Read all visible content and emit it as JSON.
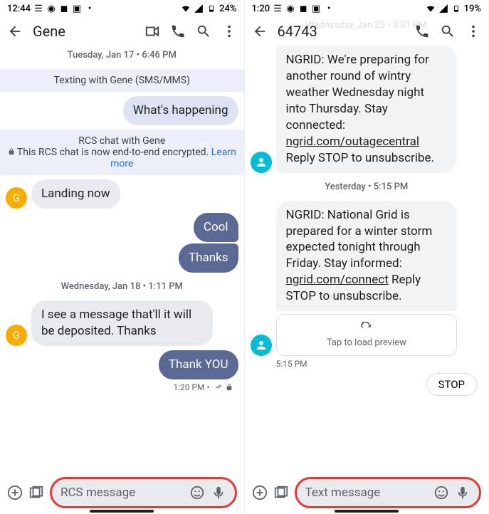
{
  "left": {
    "status": {
      "time": "12:44",
      "battery": "24%"
    },
    "header": {
      "title": "Gene"
    },
    "ts1": "Tuesday, Jan 17 • 6:46 PM",
    "banner1": "Texting with Gene (SMS/MMS)",
    "m1": "What's happening",
    "rcs_line1": "RCS chat with Gene",
    "rcs_line2": "This RCS chat is now end-to-end encrypted. ",
    "rcs_link": "Learn more",
    "avatar_g": "G",
    "m2": "Landing now",
    "m3": "Cool",
    "m4": "Thanks",
    "ts2": "Wednesday, Jan 18 • 1:11 PM",
    "m5": "I see a message that'll it will be deposited. Thanks",
    "m6": "Thank YOU",
    "ts3": "1:20 PM •",
    "compose_ph": "RCS message"
  },
  "right": {
    "status": {
      "time": "1:20",
      "battery": "19%"
    },
    "faded_ts": "Wednesday, Jan 25 • 3:01 PM",
    "header": {
      "title": "64743"
    },
    "m1_pre": "NGRID: We're preparing for another round of wintry weather Wednesday night into Thursday. Stay connected: ",
    "m1_link": "ngrid.com/outagecentral",
    "m1_post": " Reply STOP to unsubscribe.",
    "ts1": "Yesterday • 5:15 PM",
    "m2_pre": "NGRID: National Grid is prepared for a winter storm expected tonight through Friday. Stay informed: ",
    "m2_link": "ngrid.com/connect",
    "m2_post": " Reply STOP to unsubscribe.",
    "preview": "Tap to load preview",
    "ts2": "5:15 PM",
    "chip": "STOP",
    "compose_ph": "Text message"
  }
}
